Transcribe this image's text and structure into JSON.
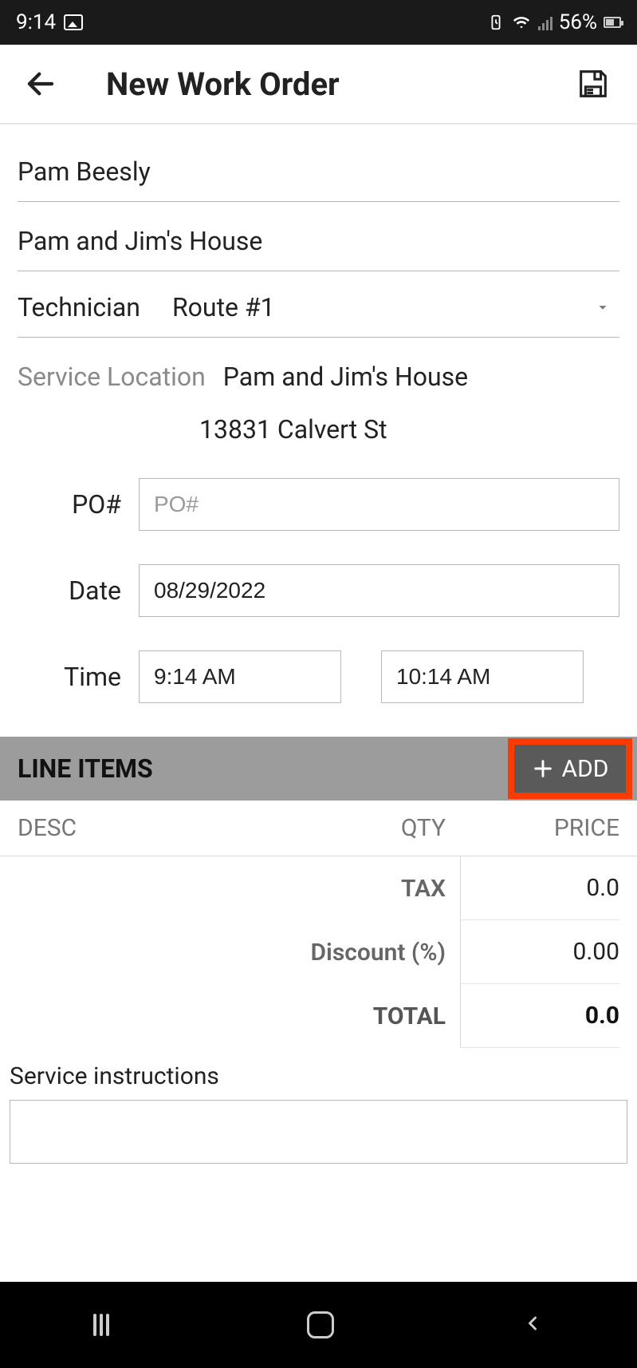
{
  "status": {
    "time": "9:14",
    "battery_pct": "56%"
  },
  "header": {
    "title": "New Work Order"
  },
  "customer_name": "Pam Beesly",
  "site_name": "Pam and Jim's House",
  "technician": {
    "label": "Technician",
    "value": "Route #1"
  },
  "service_location": {
    "label": "Service Location",
    "name": "Pam and Jim's House",
    "address": "13831 Calvert St"
  },
  "po": {
    "label": "PO#",
    "placeholder": "PO#",
    "value": ""
  },
  "date": {
    "label": "Date",
    "value": "08/29/2022"
  },
  "time": {
    "label": "Time",
    "start": "9:14 AM",
    "end": "10:14 AM"
  },
  "line_items": {
    "section_title": "LINE ITEMS",
    "add_label": "ADD",
    "columns": {
      "desc": "DESC",
      "qty": "QTY",
      "price": "PRICE"
    },
    "rows": []
  },
  "totals": {
    "tax_label": "TAX",
    "tax_value": "0.0",
    "discount_label": "Discount (%)",
    "discount_value": "0.00",
    "total_label": "TOTAL",
    "total_value": "0.0"
  },
  "service_instructions": {
    "label": "Service instructions",
    "value": ""
  }
}
